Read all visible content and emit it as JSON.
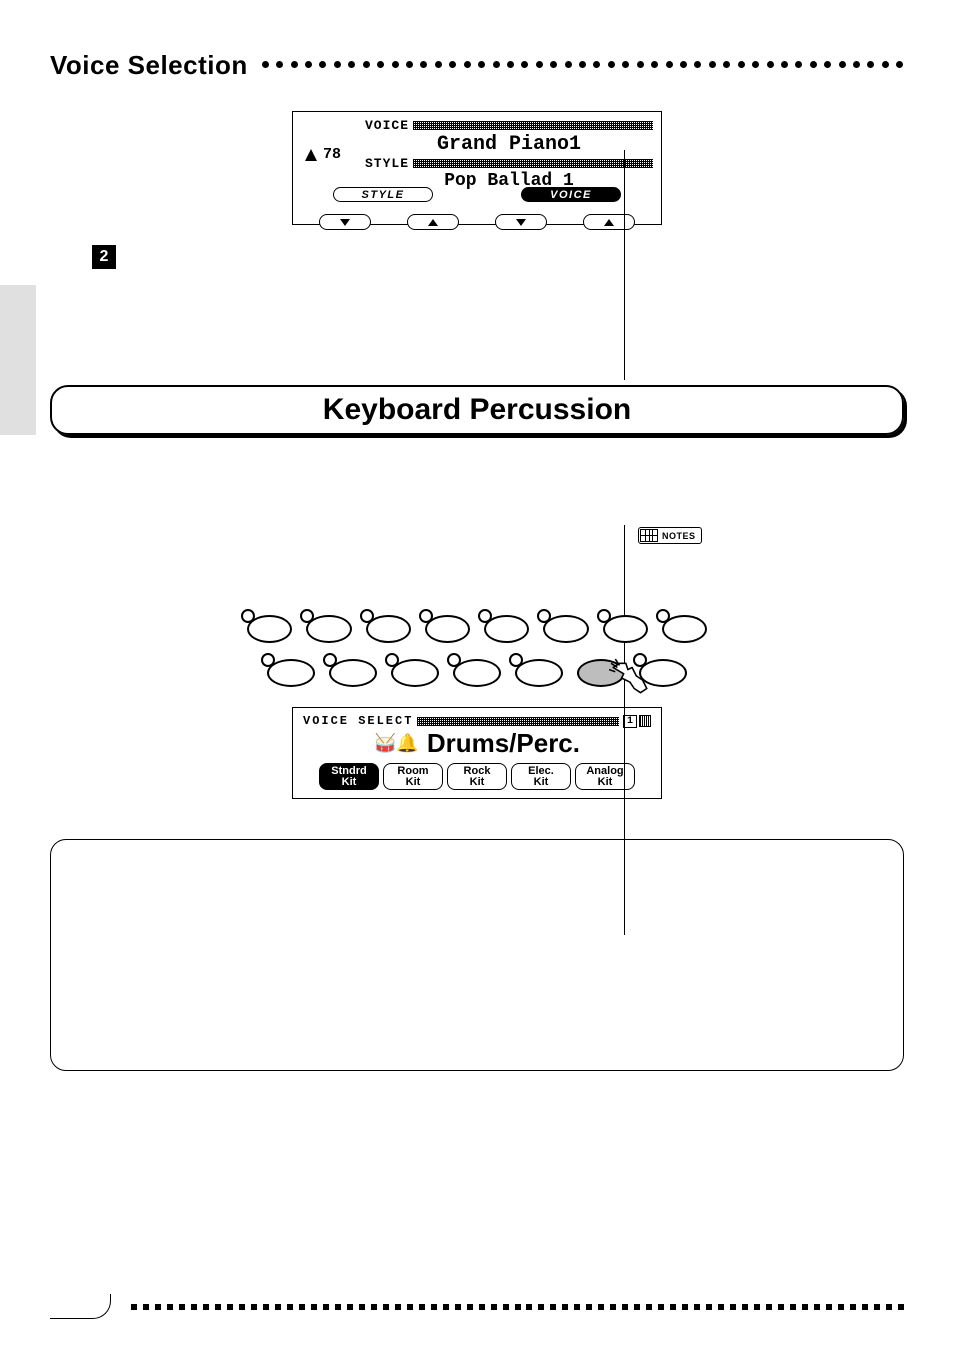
{
  "header": {
    "title": "Voice Selection"
  },
  "lcd1": {
    "voice_label": "VOICE",
    "voice_name": "Grand Piano1",
    "style_label": "STYLE",
    "style_name": "Pop Ballad 1",
    "tempo": "78",
    "btn_style": "STYLE",
    "btn_voice": "VOICE"
  },
  "step2": {
    "number": "2"
  },
  "kp": {
    "title": "Keyboard Percussion"
  },
  "notes": {
    "label": "NOTES"
  },
  "lcd2": {
    "top_label": "VOICE SELECT",
    "page_indicator": "1",
    "main": "Drums/Perc.",
    "kits": [
      {
        "l1": "Stndrd",
        "l2": "Kit",
        "selected": true
      },
      {
        "l1": "Room",
        "l2": "Kit",
        "selected": false
      },
      {
        "l1": "Rock",
        "l2": "Kit",
        "selected": false
      },
      {
        "l1": "Elec.",
        "l2": "Kit",
        "selected": false
      },
      {
        "l1": "Analog",
        "l2": "Kit",
        "selected": false
      }
    ]
  }
}
